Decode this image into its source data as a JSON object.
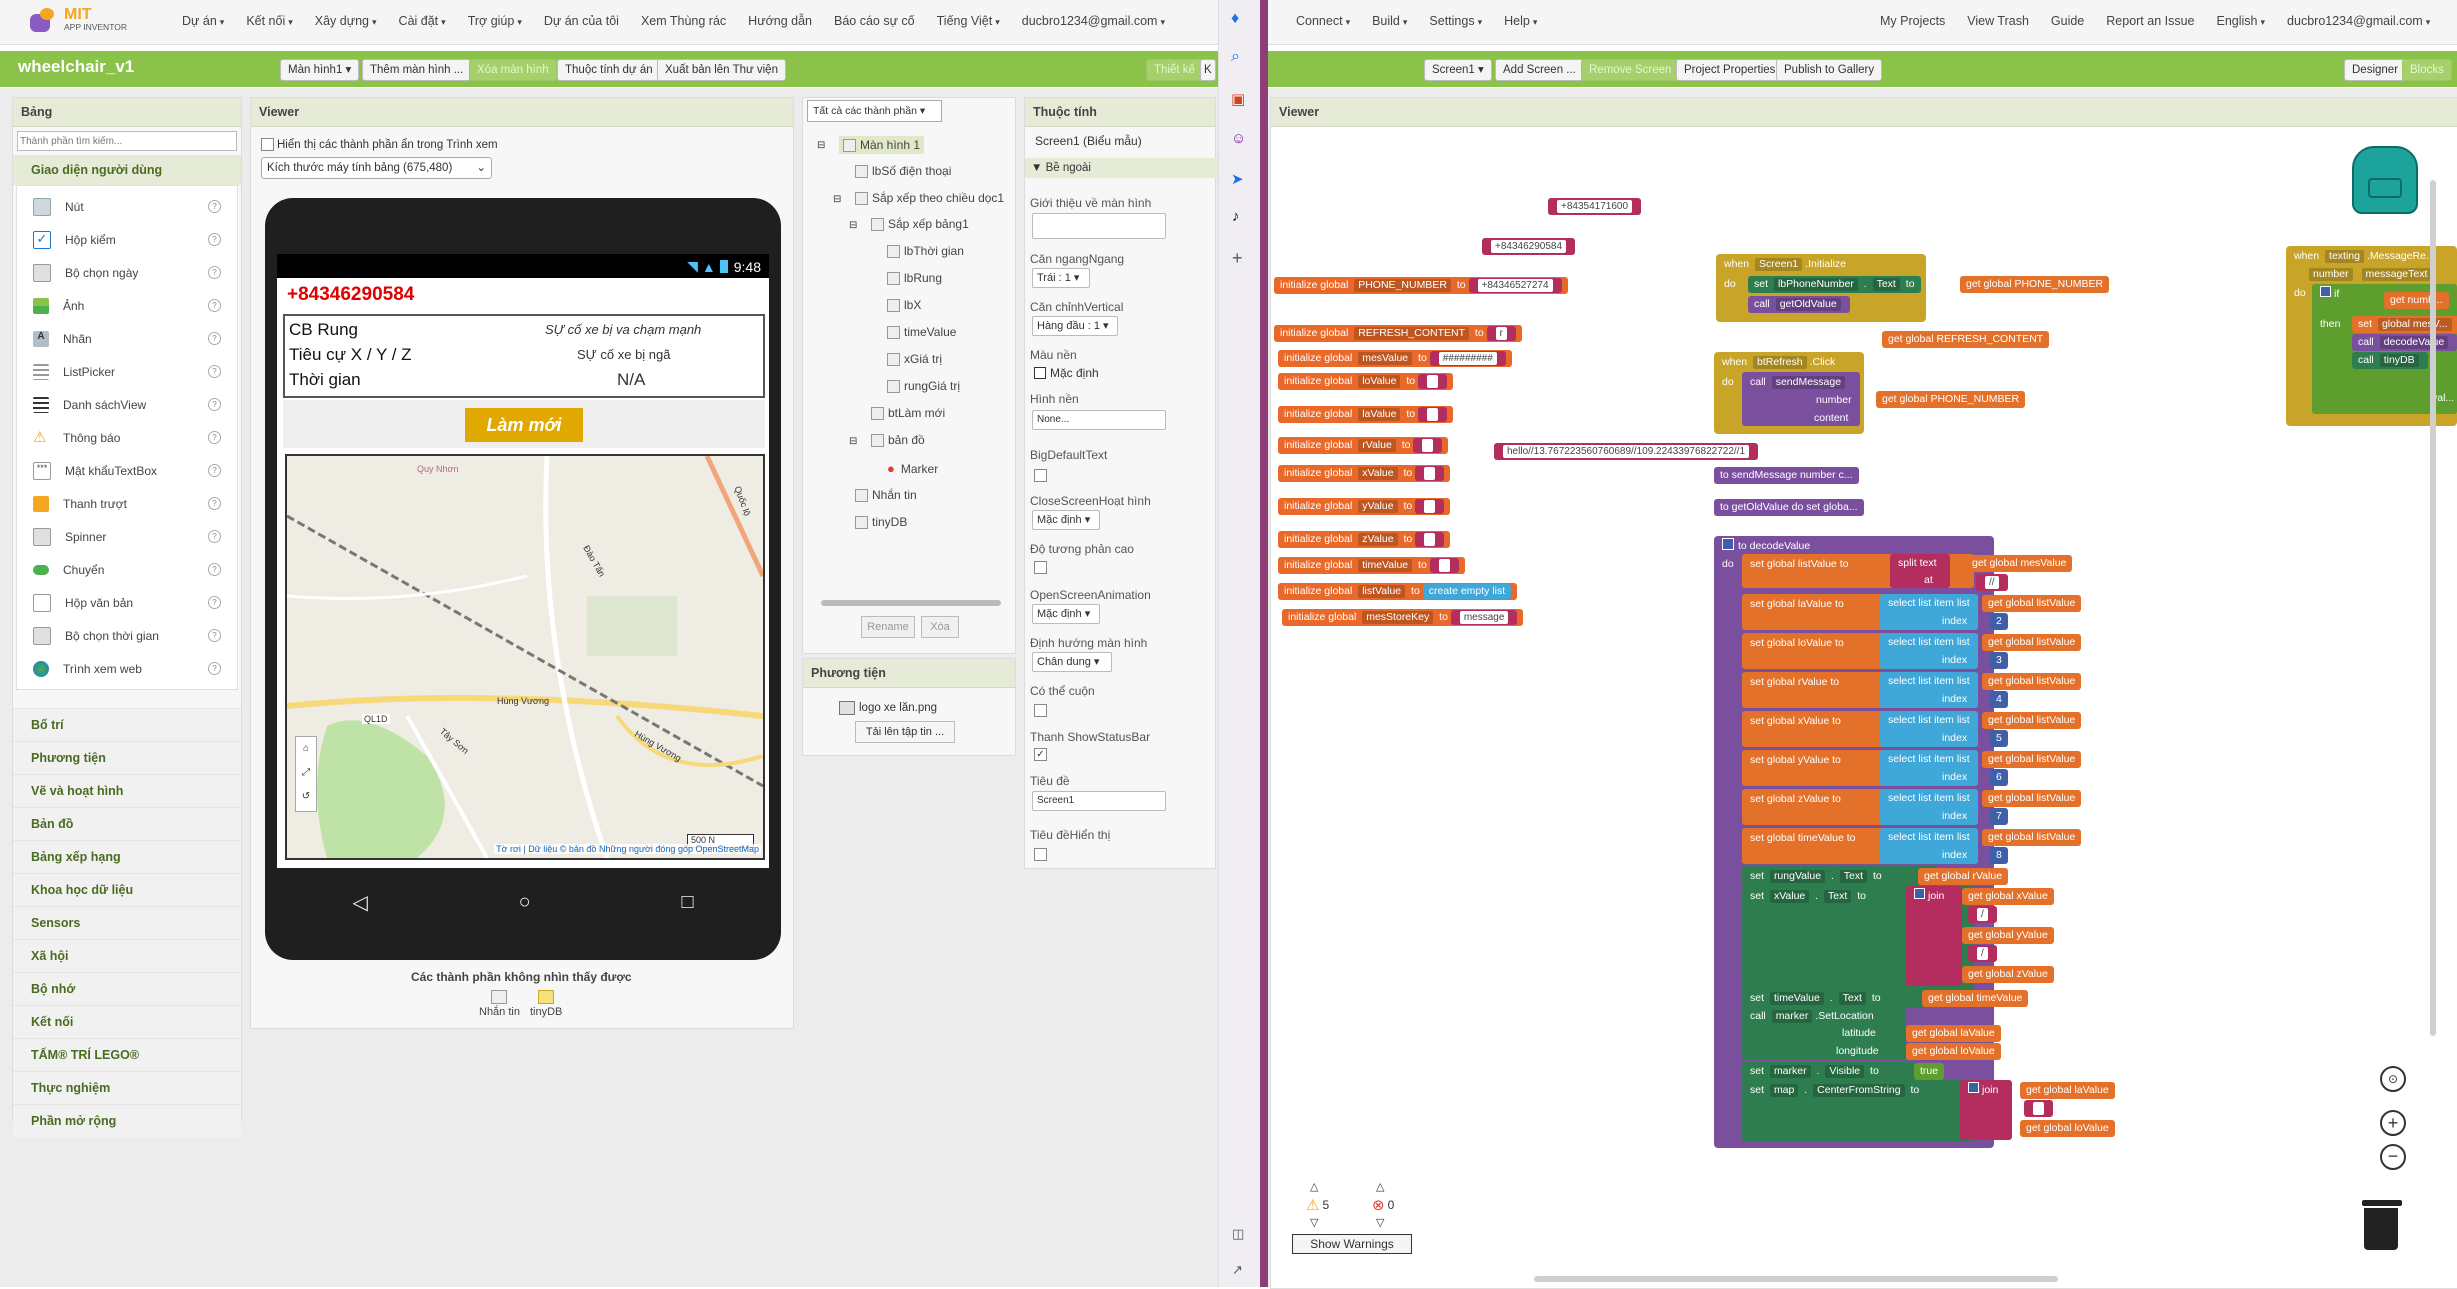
{
  "left": {
    "logo": {
      "brand": "MIT",
      "sub": "APP INVENTOR"
    },
    "menu": [
      "Dự án",
      "Kết nối",
      "Xây dựng",
      "Cài đặt",
      "Trợ giúp"
    ],
    "links": [
      "Dự án của tôi",
      "Xem Thùng rác",
      "Hướng dẫn",
      "Báo cáo sự cố",
      "Tiếng Việt",
      "ducbro1234@gmail.com"
    ],
    "project_title": "wheelchair_v1",
    "toolbar": {
      "screen_select": "Màn hình1",
      "add_screen": "Thêm màn hình ...",
      "remove_screen": "Xóa màn hình",
      "properties": "Thuộc tính dự án",
      "publish": "Xuất bản lên Thư viện",
      "designer": "Thiết kế",
      "blocks": "K"
    },
    "palette": {
      "title": "Bảng",
      "search_placeholder": "Thành phần tìm kiếm...",
      "open_category": "Giao diện người dùng",
      "items": [
        "Nút",
        "Hộp kiểm",
        "Bộ chọn ngày",
        "Ảnh",
        "Nhãn",
        "ListPicker",
        "Danh sáchView",
        "Thông báo",
        "Mật khẩuTextBox",
        "Thanh trượt",
        "Spinner",
        "Chuyển",
        "Hộp văn bản",
        "Bộ chọn thời gian",
        "Trình xem web"
      ],
      "categories": [
        "Bố trí",
        "Phương tiện",
        "Vẽ và hoạt hình",
        "Bản đồ",
        "Bảng xếp hạng",
        "Khoa học dữ liệu",
        "Sensors",
        "Xã hội",
        "Bộ nhớ",
        "Kết nối",
        "TẤM® TRÍ LEGO®",
        "Thực nghiệm",
        "Phần mở rộng"
      ]
    },
    "viewer": {
      "title": "Viewer",
      "hidden_checkbox": "Hiển thị các thành phần ẩn trong Trình xem",
      "size_select": "Kích thước máy tính bảng (675,480)",
      "phone": {
        "time": "9:48",
        "phone_number": "+84346290584",
        "rows": [
          {
            "label": "CB Rung",
            "value": "SỰ cố xe bị va chạm mạnh"
          },
          {
            "label": "Tiêu cự X / Y / Z",
            "value": "SỰ cố xe bị ngã"
          },
          {
            "label": "Thời gian",
            "value": "N/A"
          }
        ],
        "refresh_btn": "Làm mới",
        "map_labels": [
          "Quy Nhơn",
          "QL1D",
          "Hùng Vương",
          "Hùng Vương",
          "Đào Tấn",
          "Tây Sơn",
          "Quốc lộ",
          "500 N"
        ],
        "attribution": "Tờ rơi | Dữ liệu © bản đồ Những người đóng góp OpenStreetMap"
      },
      "nonvisible_title": "Các thành phần không nhìn thấy được",
      "nonvisible": [
        "Nhắn tin",
        "tinyDB"
      ]
    },
    "components": {
      "dropdown": "Tất cả các thành phần",
      "tree": [
        "Màn hình 1",
        "lbSố điện thoại",
        "Sắp xếp theo chiều dọc1",
        "Sắp xếp bảng1",
        "lbThời gian",
        "lbRung",
        "lbX",
        "timeValue",
        "xGiá trị",
        "rungGiá trị",
        "btLàm mới",
        "bản đồ",
        "Marker",
        "Nhắn tin",
        "tinyDB"
      ],
      "rename": "Rename",
      "delete": "Xóa",
      "media_title": "Phương tiện",
      "media_file": "logo xe lăn.png",
      "upload": "Tải lên tập tin ..."
    },
    "properties": {
      "title": "Thuộc tính",
      "screen": "Screen1 (Biểu mẫu)",
      "section": "Bề ngoài",
      "labels": [
        "Giới thiệu về màn hình",
        "Căn ngangNgang",
        "Căn chỉnhVertical",
        "Màu nền",
        "Hình nền",
        "BigDefaultText",
        "CloseScreenHoạt hình",
        "Độ tương phản cao",
        "OpenScreenAnimation",
        "Định hướng màn hình",
        "Có thể cuộn",
        "Thanh ShowStatusBar",
        "Tiêu đề",
        "Tiêu đềHiển thị"
      ],
      "values": {
        "align_h": "Trái : 1",
        "align_v": "Hàng đầu : 1",
        "bg_color": "Mặc định",
        "bg_image": "None...",
        "close_anim": "Mặc định",
        "open_anim": "Mặc định",
        "orientation": "Chân dung",
        "title": "Screen1"
      }
    }
  },
  "right": {
    "menu": [
      "Connect",
      "Build",
      "Settings",
      "Help"
    ],
    "links": [
      "My Projects",
      "View Trash",
      "Guide",
      "Report an Issue",
      "English",
      "ducbro1234@gmail.com"
    ],
    "toolbar": {
      "screen": "Screen1",
      "add": "Add Screen ...",
      "remove": "Remove Screen",
      "props": "Project Properties",
      "publish": "Publish to Gallery",
      "designer": "Designer",
      "blocks": "Blocks"
    },
    "viewer_title": "Viewer",
    "warnings": {
      "count": "5",
      "errors": "0",
      "button": "Show Warnings"
    },
    "blocks": {
      "texts": [
        "+84354171600",
        "+84346290584"
      ],
      "globals": [
        {
          "name": "PHONE_NUMBER",
          "value": "+84346527274"
        },
        {
          "name": "REFRESH_CONTENT",
          "value": "r"
        },
        {
          "name": "mesValue",
          "value": "#########"
        },
        {
          "name": "loValue",
          "value": ""
        },
        {
          "name": "laValue",
          "value": ""
        },
        {
          "name": "rValue",
          "value": ""
        },
        {
          "name": "xValue",
          "value": ""
        },
        {
          "name": "yValue",
          "value": ""
        },
        {
          "name": "zValue",
          "value": ""
        },
        {
          "name": "timeValue",
          "value": ""
        },
        {
          "name": "listValue",
          "value": "create empty list"
        },
        {
          "name": "mesStoreKey",
          "value": "message"
        }
      ],
      "hello_text": "hello//13.767223560760689//109.22433976822722//1",
      "screen_init": {
        "when": "when",
        "comp": "Screen1",
        "event": ".Initialize",
        "do": "do",
        "set": "set",
        "target": "lbPhoneNumber",
        "prop": "Text",
        "to": "to",
        "get": "get global PHONE_NUMBER",
        "call": "call",
        "proc": "getOldValue"
      },
      "get_refresh": "get global REFRESH_CONTENT",
      "btn_click": {
        "when": "when",
        "comp": "btRefresh",
        "event": ".Click",
        "do": "do",
        "call": "call",
        "proc": "sendMessage",
        "number": "number",
        "content": "content",
        "get": "get global PHONE_NUMBER"
      },
      "proc_defs": [
        "to sendMessage  number  c...",
        "to getOldValue do set globa..."
      ],
      "decode": {
        "header": "to decodeValue",
        "do": "do",
        "split": {
          "set": "set global listValue",
          "to": "to",
          "split": "split",
          "text": "text",
          "at": "at",
          "get": "get global mesValue",
          "sep": "//"
        },
        "rows": [
          {
            "set": "set global laValue",
            "to": "to",
            "sel": "select list item  list",
            "get": "get global listValue",
            "index_lbl": "index",
            "index": "2"
          },
          {
            "set": "set global loValue",
            "to": "to",
            "sel": "select list item  list",
            "get": "get global listValue",
            "index_lbl": "index",
            "index": "3"
          },
          {
            "set": "set global rValue",
            "to": "to",
            "sel": "select list item  list",
            "get": "get global listValue",
            "index_lbl": "index",
            "index": "4"
          },
          {
            "set": "set global xValue",
            "to": "to",
            "sel": "select list item  list",
            "get": "get global listValue",
            "index_lbl": "index",
            "index": "5"
          },
          {
            "set": "set global yValue",
            "to": "to",
            "sel": "select list item  list",
            "get": "get global listValue",
            "index_lbl": "index",
            "index": "6"
          },
          {
            "set": "set global zValue",
            "to": "to",
            "sel": "select list item  list",
            "get": "get global listValue",
            "index_lbl": "index",
            "index": "7"
          },
          {
            "set": "set global timeValue",
            "to": "to",
            "sel": "select list item  list",
            "get": "get global listValue",
            "index_lbl": "index",
            "index": "8"
          }
        ],
        "rung": {
          "set": "set",
          "comp": "rungValue",
          "prop": "Text",
          "to": "to",
          "get": "get global rValue"
        },
        "xval": {
          "set": "set",
          "comp": "xValue",
          "prop": "Text",
          "to": "to",
          "join": "join",
          "items": [
            "get global xValue",
            "/",
            "get global yValue",
            "/",
            "get global zValue"
          ]
        },
        "time": {
          "set": "set",
          "comp": "timeValue",
          "prop": "Text",
          "to": "to",
          "get": "get global timeValue"
        },
        "marker": {
          "call": "call",
          "comp": "marker",
          "method": ".SetLocation",
          "lat": "latitude",
          "lon": "longitude",
          "get_la": "get global laValue",
          "get_lo": "get global loValue"
        },
        "visible": {
          "set": "set",
          "comp": "marker",
          "prop": "Visible",
          "to": "to",
          "val": "true"
        },
        "center": {
          "set": "set",
          "comp": "map",
          "prop": "CenterFromString",
          "to": "to",
          "join": "join",
          "items": [
            "get global laValue",
            "",
            "get global loValue"
          ]
        }
      },
      "texting": {
        "when": "when",
        "comp": "texting",
        "event": ".MessageRe...",
        "params": [
          "number",
          "messageText"
        ],
        "do": "do",
        "if": "if",
        "then": "then",
        "get": "get numb...",
        "set": "set",
        "setv": "global mesV...",
        "call1": "call",
        "proc1": "decodeValue",
        "call2": "call",
        "proc2": "tinyDB",
        "tail": "val..."
      }
    }
  },
  "colors": {
    "green": "#8bc34a",
    "init": "#e8692a",
    "text": "#b32d5e",
    "list": "#3fa8d9",
    "proc": "#7a4f9e"
  }
}
